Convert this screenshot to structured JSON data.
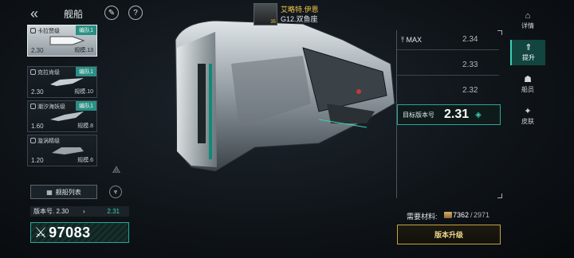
{
  "header": {
    "title": "舰船",
    "back_icon": "back-chevron-icon",
    "pencil_icon": "edit-icon",
    "help_icon": "help-icon"
  },
  "ship_list": [
    {
      "name": "卡拉赞级",
      "badge": "编队1",
      "version": "2.30",
      "scale": "规模.13",
      "selected": true
    },
    {
      "name": "克拉肯级",
      "badge": "编队1",
      "version": "2.30",
      "scale": "规模.10",
      "selected": false
    },
    {
      "name": "潮汐海妖级",
      "badge": "编队1",
      "version": "1.60",
      "scale": "规模.8",
      "selected": false
    },
    {
      "name": "漩涡精级",
      "badge": "",
      "version": "1.20",
      "scale": "规模.6",
      "selected": false
    }
  ],
  "fleet_button": {
    "label": "舰船列表",
    "icon": "grid-icon"
  },
  "version_bar": {
    "label": "版本号. 2.30",
    "arrow": "›",
    "new_version": "2.31"
  },
  "power": {
    "icon": "crossed-swords-icon",
    "value": "97083"
  },
  "commander": {
    "name": "艾略特.伊恩",
    "level": "35",
    "subtitle": "G12.双鱼座"
  },
  "version_panel": {
    "max_label": "MAX",
    "versions_above": [
      "2.34",
      "2.33",
      "2.32"
    ],
    "target_label": "目标版本号",
    "target_value": "2.31"
  },
  "materials": {
    "label": "需要材料:",
    "current": "7362",
    "separator": "/",
    "required": "2971"
  },
  "upgrade_button": {
    "label": "版本升级"
  },
  "right_nav": [
    {
      "label": "详情",
      "icon": "detail-icon",
      "active": false
    },
    {
      "label": "提升",
      "icon": "upgrade-icon",
      "active": true
    },
    {
      "label": "船员",
      "icon": "crew-icon",
      "active": false
    },
    {
      "label": "皮肤",
      "icon": "skin-icon",
      "active": false
    }
  ],
  "colors": {
    "accent": "#39d0b4",
    "badge": "#2a8f83",
    "gold": "#f3c64a"
  }
}
